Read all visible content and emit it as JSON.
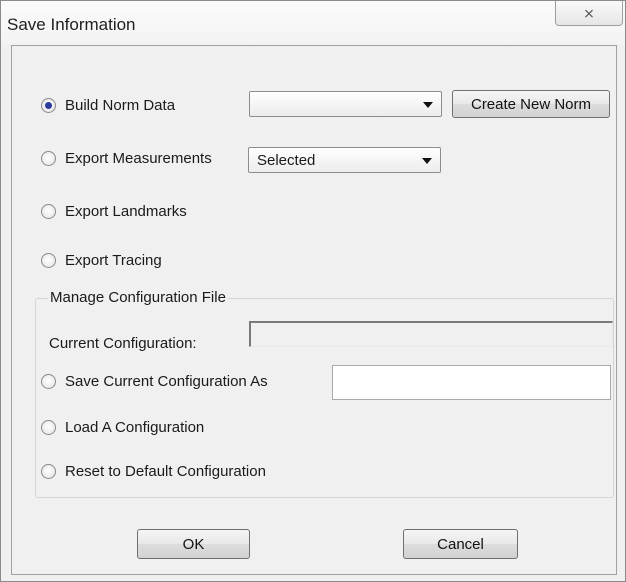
{
  "window": {
    "title": "Save Information",
    "close_glyph": "⨯"
  },
  "options": {
    "build_norm_data": "Build Norm Data",
    "export_measurements": "Export Measurements",
    "export_landmarks": "Export Landmarks",
    "export_tracing": "Export Tracing"
  },
  "norm_combo": {
    "selected": ""
  },
  "create_norm_button": "Create New Norm",
  "measurements_combo": {
    "selected": "Selected"
  },
  "config": {
    "group_title": "Manage Configuration File",
    "current_label": "Current Configuration:",
    "current_value": "",
    "save_as_label": "Save Current Configuration As",
    "save_as_value": "",
    "load_label": "Load A Configuration",
    "reset_label": "Reset to Default Configuration"
  },
  "buttons": {
    "ok": "OK",
    "cancel": "Cancel"
  },
  "selected_option": "build_norm_data",
  "colors": {
    "radio_dot": "#2a3c9b",
    "window_bg": "#f0f0f0"
  }
}
